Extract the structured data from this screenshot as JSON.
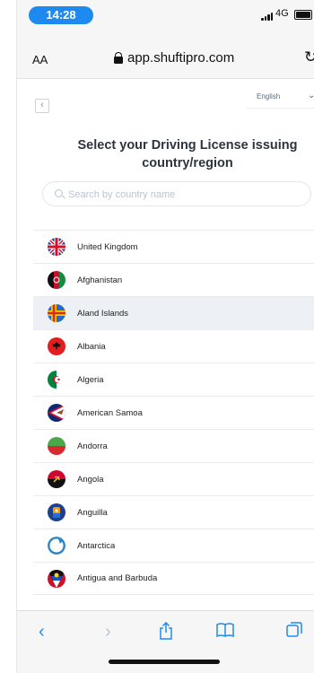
{
  "status_bar": {
    "time": "14:28",
    "network": "4G"
  },
  "browser": {
    "text_size_label": "AA",
    "url": "app.shuftipro.com"
  },
  "page": {
    "language": "English",
    "title": "Select your Driving License issuing country/region",
    "search": {
      "placeholder": "Search by country name",
      "value": ""
    }
  },
  "countries": [
    {
      "name": "United Kingdom",
      "flag": "uk-flag-icon"
    },
    {
      "name": "Afghanistan",
      "flag": "afghanistan-flag-icon"
    },
    {
      "name": "Aland Islands",
      "flag": "aland-flag-icon",
      "selected": true
    },
    {
      "name": "Albania",
      "flag": "albania-flag-icon"
    },
    {
      "name": "Algeria",
      "flag": "algeria-flag-icon"
    },
    {
      "name": "American Samoa",
      "flag": "american-samoa-flag-icon"
    },
    {
      "name": "Andorra",
      "flag": "andorra-flag-icon"
    },
    {
      "name": "Angola",
      "flag": "angola-flag-icon"
    },
    {
      "name": "Anguilla",
      "flag": "anguilla-flag-icon"
    },
    {
      "name": "Antarctica",
      "flag": "antarctica-flag-icon"
    },
    {
      "name": "Antigua and Barbuda",
      "flag": "antigua-flag-icon"
    }
  ],
  "colors": {
    "accent": "#1e8af0",
    "selected_row": "#edf0f4",
    "title": "#2d3440"
  }
}
